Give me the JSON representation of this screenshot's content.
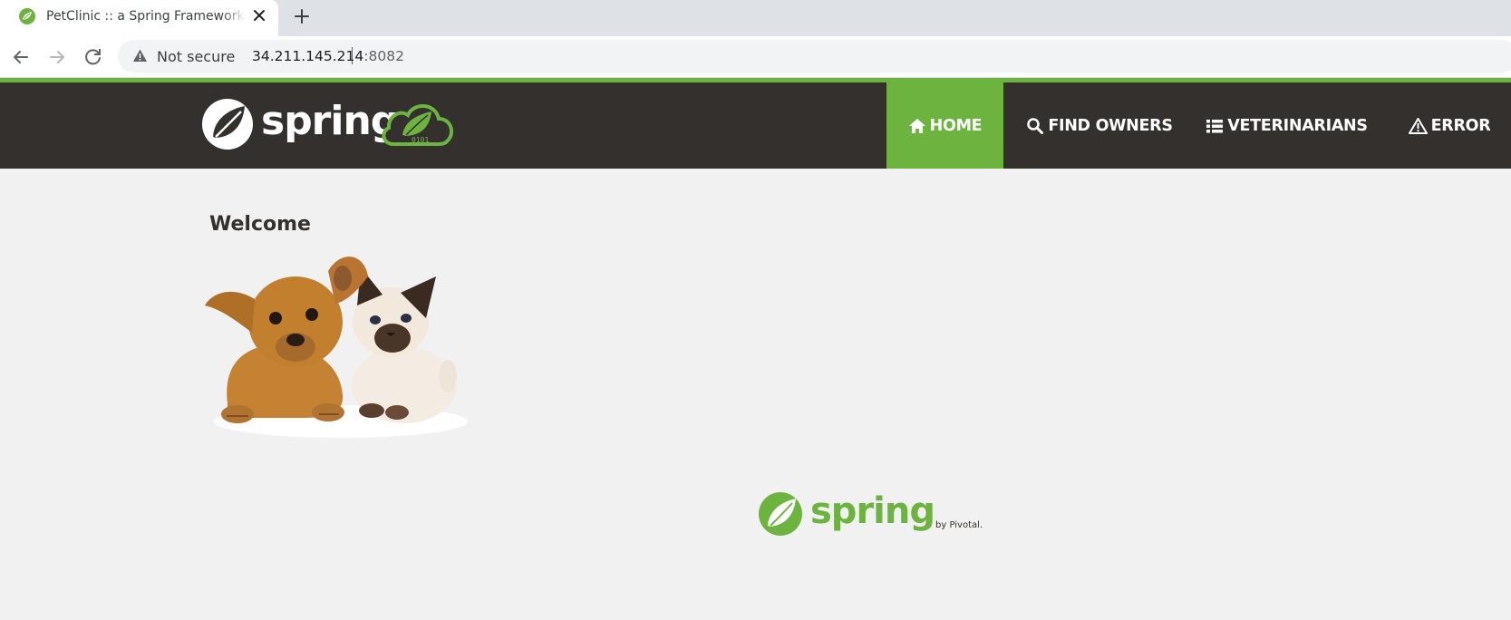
{
  "browser": {
    "tab_title": "PetClinic :: a Spring Framework demonstration",
    "security_label": "Not secure",
    "url_host": "34.211.145.214",
    "url_port": ":8082"
  },
  "nav": {
    "brand_text": "spring",
    "brand_badge_text": "0101",
    "items": [
      {
        "label": "HOME",
        "icon": "home-icon",
        "active": true
      },
      {
        "label": "FIND OWNERS",
        "icon": "search-icon",
        "active": false
      },
      {
        "label": "VETERINARIANS",
        "icon": "list-icon",
        "active": false
      },
      {
        "label": "ERROR",
        "icon": "warning-icon",
        "active": false
      }
    ]
  },
  "main": {
    "heading": "Welcome"
  },
  "footer": {
    "logo_text": "spring",
    "by_text": "by Pivotal."
  },
  "colors": {
    "spring_green": "#6db33f",
    "navbar_bg": "#34302d",
    "page_bg": "#f1f1f1"
  }
}
